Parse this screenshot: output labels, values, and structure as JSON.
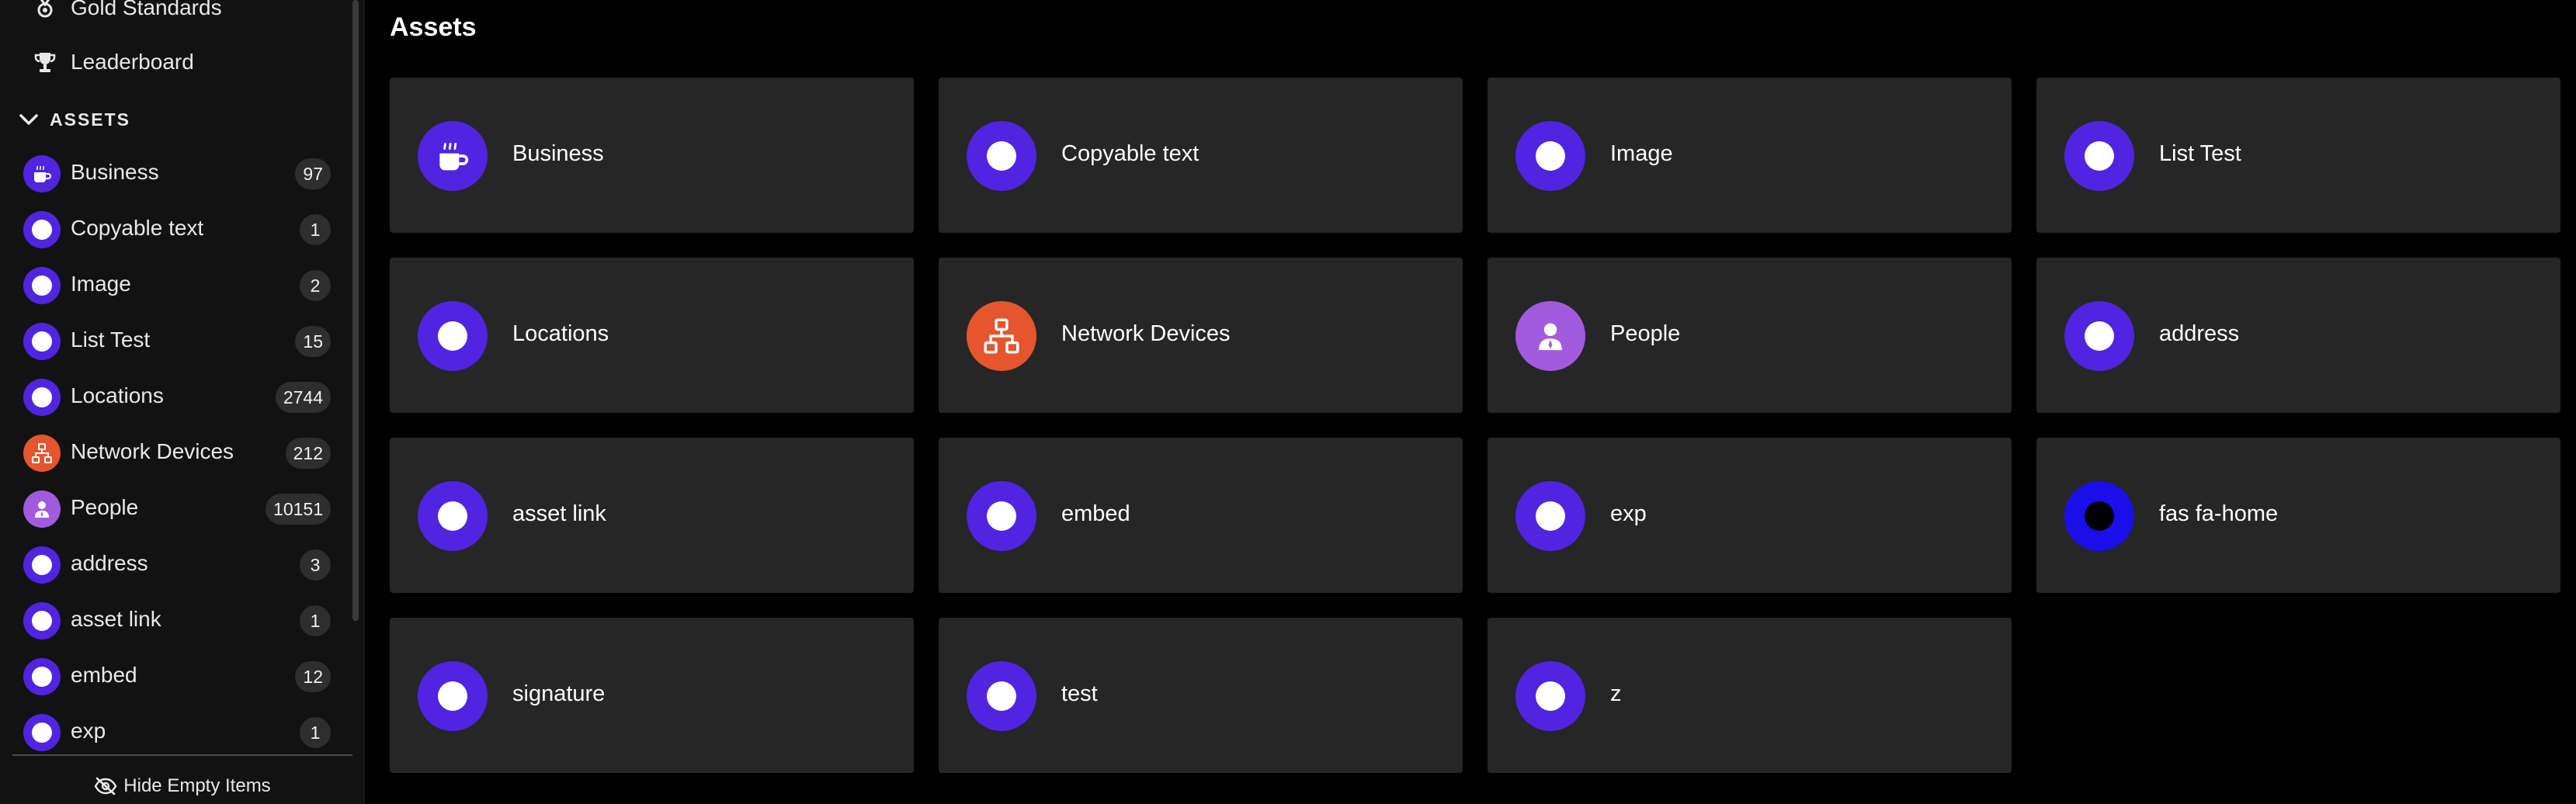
{
  "colors": {
    "primary_purple": "#5024e0",
    "network_orange": "#e5552e",
    "people_purple": "#a25bdf",
    "fas_blue": "#1a0fe8"
  },
  "sidebar": {
    "nav": [
      {
        "label": "Gold Standards",
        "icon": "medal-icon"
      },
      {
        "label": "Leaderboard",
        "icon": "trophy-icon"
      }
    ],
    "section_title": "ASSETS",
    "items": [
      {
        "label": "Business",
        "count": "97",
        "icon": "coffee-icon"
      },
      {
        "label": "Copyable text",
        "count": "1",
        "icon": "circle-icon"
      },
      {
        "label": "Image",
        "count": "2",
        "icon": "circle-icon"
      },
      {
        "label": "List Test",
        "count": "15",
        "icon": "circle-icon"
      },
      {
        "label": "Locations",
        "count": "2744",
        "icon": "circle-icon"
      },
      {
        "label": "Network Devices",
        "count": "212",
        "icon": "network-icon"
      },
      {
        "label": "People",
        "count": "10151",
        "icon": "person-icon"
      },
      {
        "label": "address",
        "count": "3",
        "icon": "circle-icon"
      },
      {
        "label": "asset link",
        "count": "1",
        "icon": "circle-icon"
      },
      {
        "label": "embed",
        "count": "12",
        "icon": "circle-icon"
      },
      {
        "label": "exp",
        "count": "1",
        "icon": "circle-icon"
      }
    ],
    "hide_empty_label": "Hide Empty Items"
  },
  "main": {
    "title": "Assets",
    "cards": [
      {
        "label": "Business",
        "icon": "coffee-icon"
      },
      {
        "label": "Copyable text",
        "icon": "circle-icon"
      },
      {
        "label": "Image",
        "icon": "circle-icon"
      },
      {
        "label": "List Test",
        "icon": "circle-icon"
      },
      {
        "label": "Locations",
        "icon": "circle-icon"
      },
      {
        "label": "Network Devices",
        "icon": "network-icon"
      },
      {
        "label": "People",
        "icon": "person-icon"
      },
      {
        "label": "address",
        "icon": "circle-icon"
      },
      {
        "label": "asset link",
        "icon": "circle-icon"
      },
      {
        "label": "embed",
        "icon": "circle-icon"
      },
      {
        "label": "exp",
        "icon": "circle-icon"
      },
      {
        "label": "fas fa-home",
        "icon": "circle-icon"
      },
      {
        "label": "signature",
        "icon": "circle-icon"
      },
      {
        "label": "test",
        "icon": "circle-icon"
      },
      {
        "label": "z",
        "icon": "circle-icon"
      }
    ]
  }
}
